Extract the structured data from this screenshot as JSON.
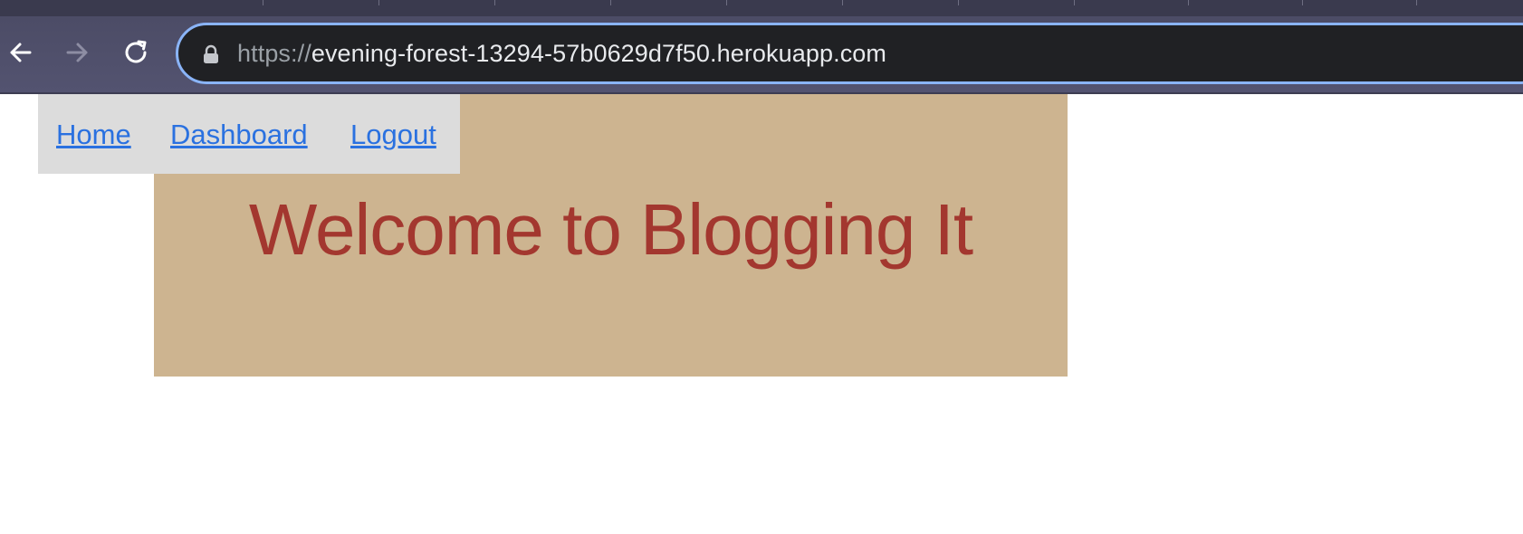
{
  "browser": {
    "url_scheme": "https://",
    "url_host": "evening-forest-13294-57b0629d7f50.herokuapp.com",
    "icons": {
      "back": "arrow-left-icon",
      "forward": "arrow-right-icon",
      "reload": "reload-icon",
      "security": "lock-icon"
    },
    "colors": {
      "toolbar": "#4c4c66",
      "omnibox": "#202124",
      "focus_ring": "#8ab4f8"
    }
  },
  "nav": {
    "links": [
      {
        "label": "Home"
      },
      {
        "label": "Dashboard"
      },
      {
        "label": "Logout"
      }
    ]
  },
  "hero": {
    "title": "Welcome to Blogging It"
  },
  "colors": {
    "hero_background": "#cdb490",
    "hero_title": "#a3372f",
    "nav_background": "#dcdcdc",
    "link": "#2a71e0"
  }
}
